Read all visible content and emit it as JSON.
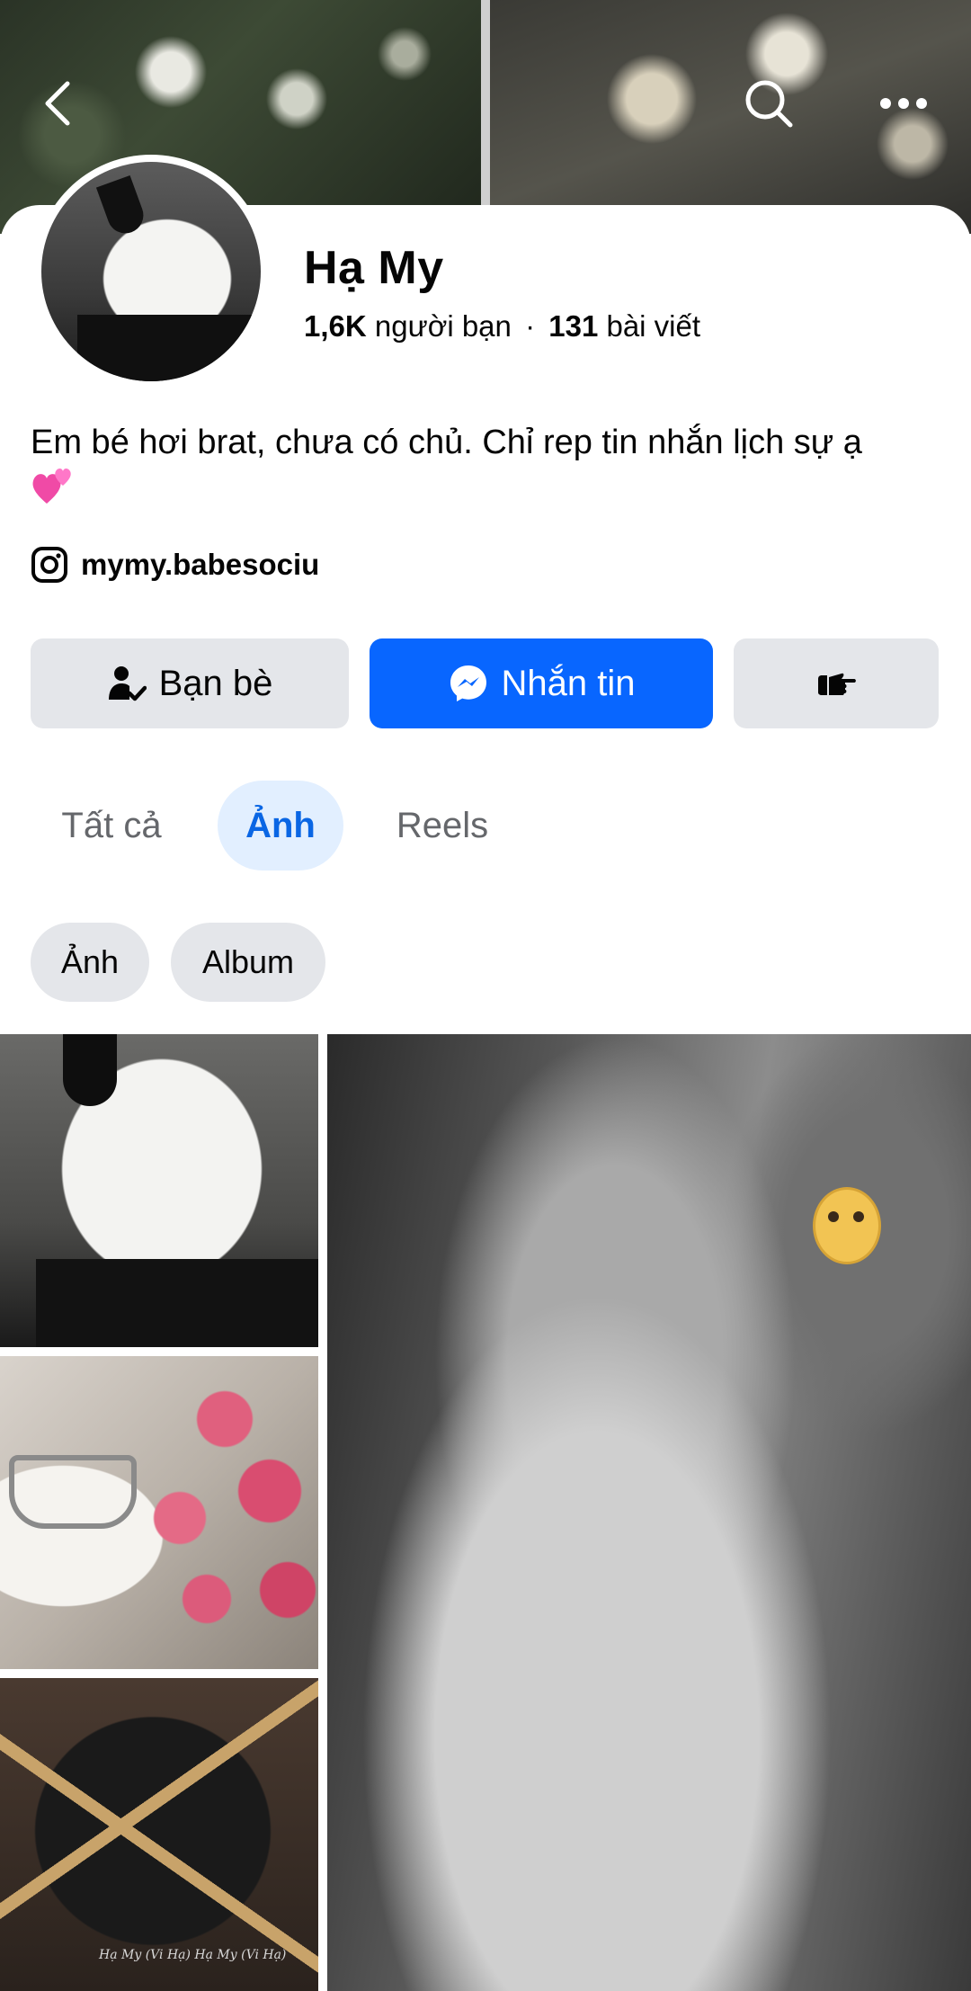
{
  "profile": {
    "name": "Hạ My",
    "friends_count": "1,6K",
    "friends_label": "người bạn",
    "separator": "·",
    "posts_count": "131",
    "posts_label": "bài viết",
    "bio": "Em bé hơi brat, chưa có chủ. Chỉ rep tin nhắn lịch sự ạ",
    "bio_emoji": "💕",
    "instagram_handle": "mymy.babesociu"
  },
  "actions": {
    "friends_label": "Bạn bè",
    "message_label": "Nhắn tin"
  },
  "tabs": [
    {
      "label": "Tất cả",
      "active": false
    },
    {
      "label": "Ảnh",
      "active": true
    },
    {
      "label": "Reels",
      "active": false
    }
  ],
  "chips": [
    {
      "label": "Ảnh"
    },
    {
      "label": "Album"
    }
  ],
  "photo_watermark": "Hạ My (Vi Hạ) Hạ My (Vi Hạ)",
  "colors": {
    "primary_blue": "#0866ff",
    "active_tab_bg": "#e2efff",
    "active_tab_text": "#0a66e4",
    "button_gray": "#e4e6ea",
    "secondary_text": "#65676b"
  },
  "icons": [
    "back-icon",
    "search-icon",
    "more-icon",
    "instagram-icon",
    "friends-check-icon",
    "messenger-icon",
    "poke-hand-icon"
  ]
}
